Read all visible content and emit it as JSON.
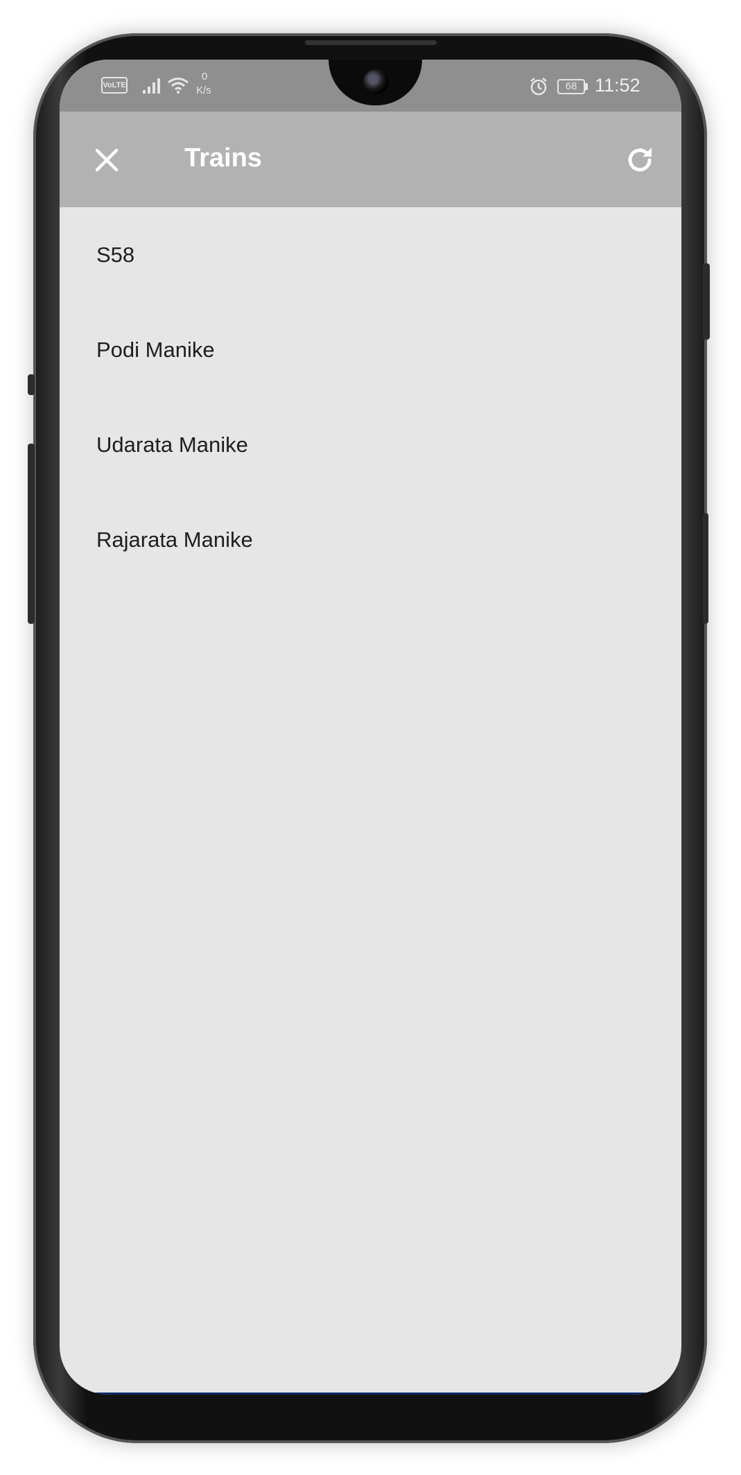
{
  "status_bar": {
    "network_badge": "VoLTE",
    "speed_value": "0",
    "speed_unit": "K/s",
    "battery": "68",
    "time": "11:52",
    "icons": [
      "volte-icon",
      "signal-icon",
      "wifi-icon",
      "alarm-icon",
      "battery-icon"
    ]
  },
  "toolbar": {
    "title": "Trains",
    "close_icon": "close-icon",
    "refresh_icon": "refresh-icon",
    "background_color": "#b2b2b2"
  },
  "trains": [
    {
      "name": "S58"
    },
    {
      "name": "Podi Manike"
    },
    {
      "name": "Udarata Manike"
    },
    {
      "name": "Rajarata Manike"
    }
  ],
  "colors": {
    "list_background": "#e6e6e6",
    "status_bar": "#8f8f8f",
    "text": "#1e1e1e"
  }
}
